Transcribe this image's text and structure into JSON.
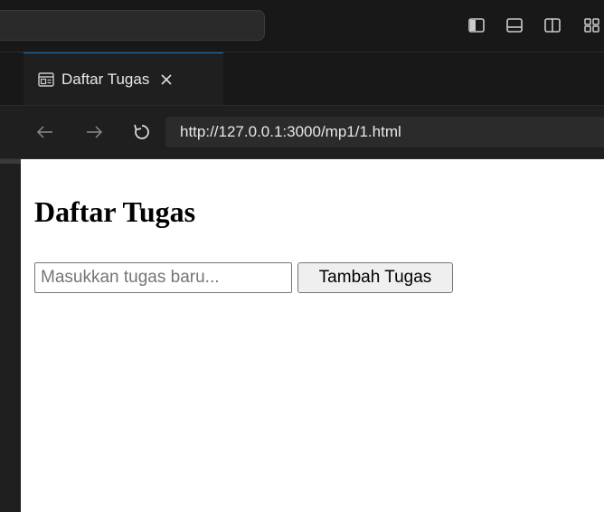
{
  "tab": {
    "title": "Daftar Tugas",
    "close_glyph": "✕",
    "icon": "preview-icon"
  },
  "navigation": {
    "back_glyph": "←",
    "forward_glyph": "→",
    "reload_glyph": "↻",
    "url": "http://127.0.0.1:3000/mp1/1.html"
  },
  "layout_controls": {
    "icons": [
      "toggle-primary-sidebar-icon",
      "toggle-panel-icon",
      "toggle-secondary-sidebar-icon",
      "customize-layout-icon"
    ]
  },
  "page": {
    "heading": "Daftar Tugas",
    "task_input": {
      "value": "",
      "placeholder": "Masukkan tugas baru..."
    },
    "add_button_label": "Tambah Tugas"
  },
  "colors": {
    "tab_accent": "#0078d4",
    "chrome_background": "#181818",
    "editor_background": "#1f1f1f",
    "page_background": "#ffffff"
  }
}
